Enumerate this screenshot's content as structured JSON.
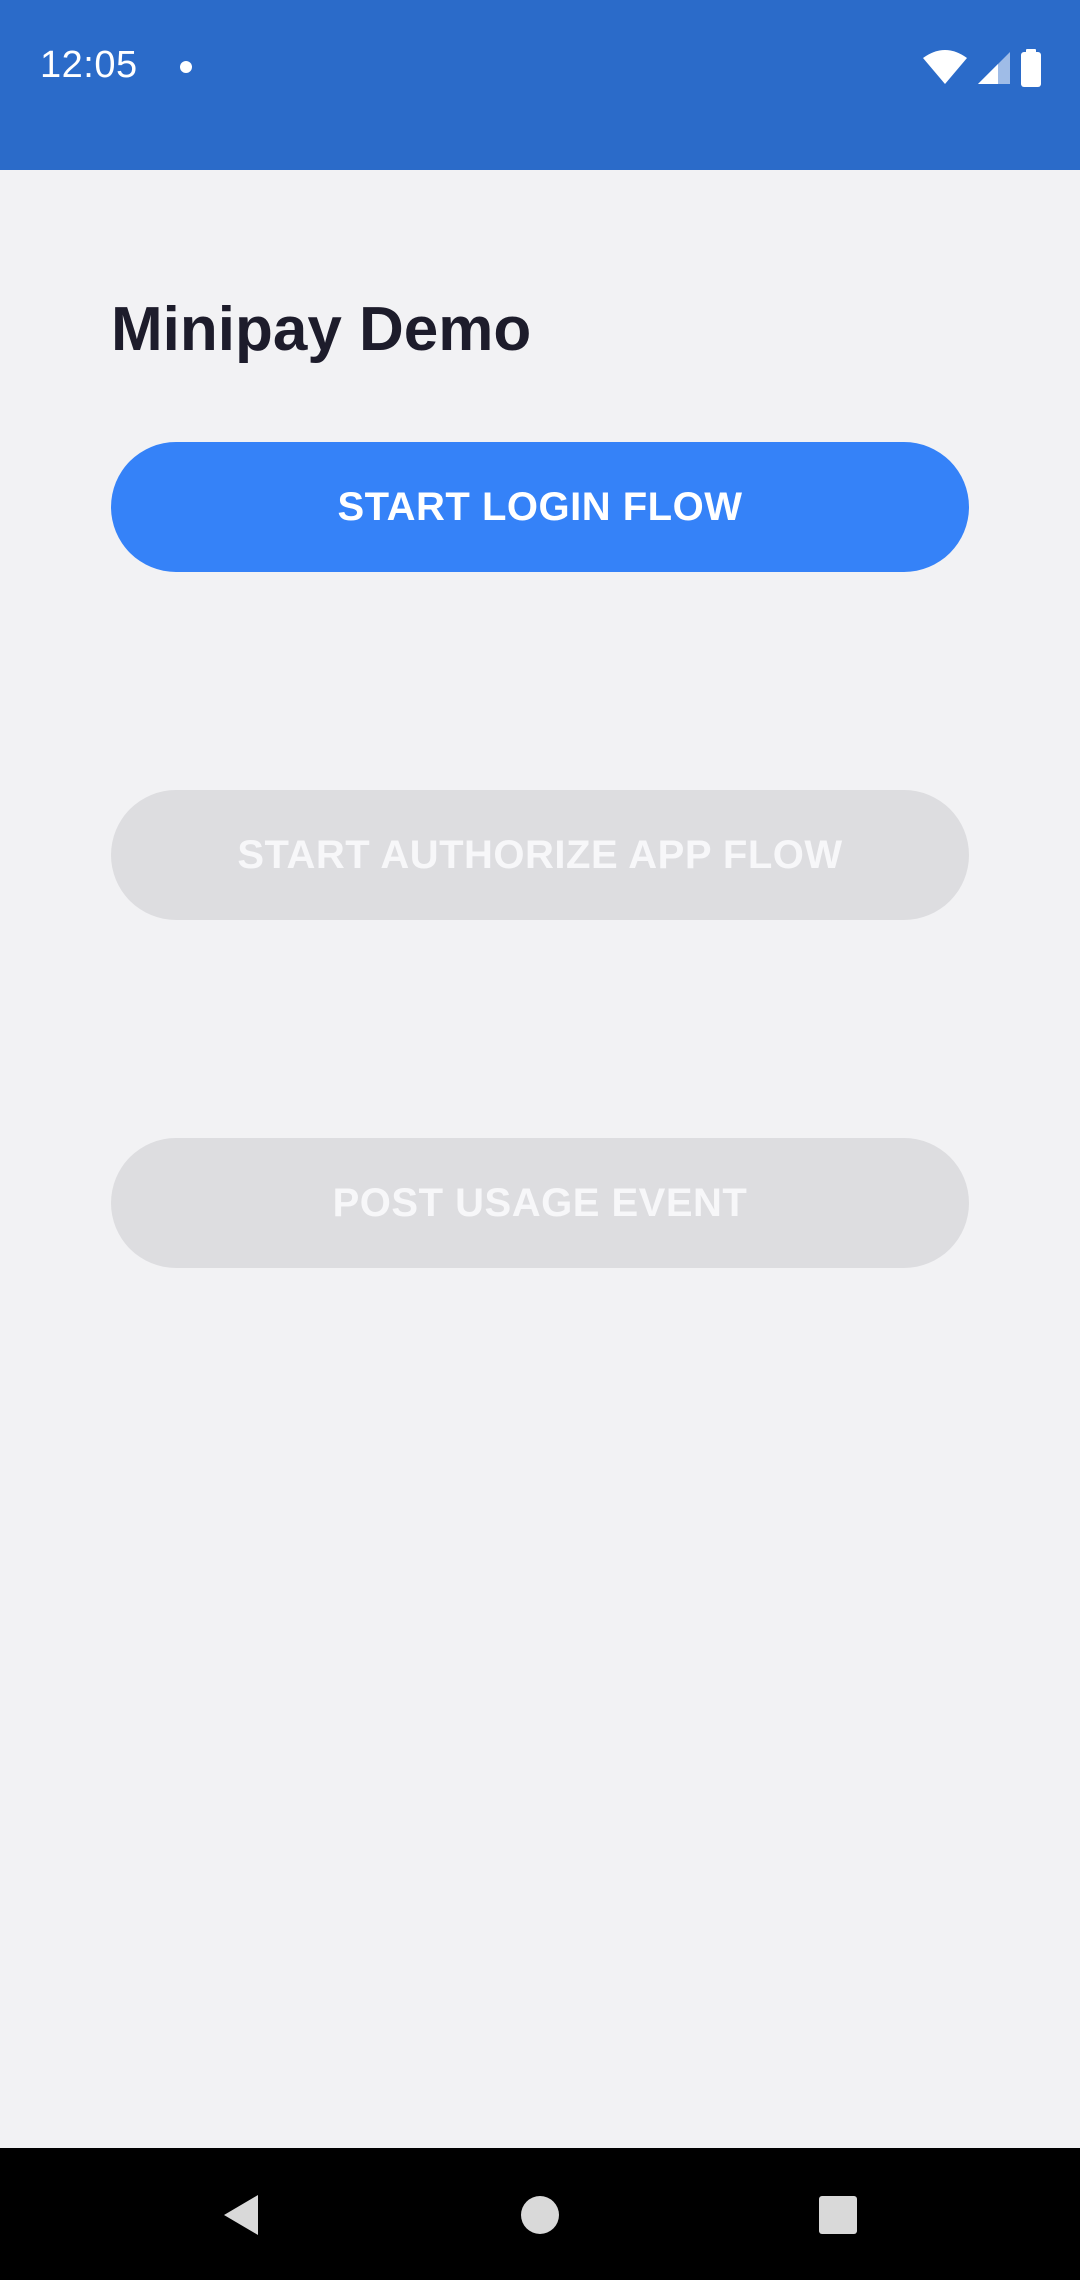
{
  "status_bar": {
    "time": "12:05",
    "background_color": "#2b6bc9",
    "icons": [
      "notification-dot-icon",
      "wifi-icon",
      "signal-icon",
      "battery-icon"
    ]
  },
  "main": {
    "title": "Minipay Demo",
    "buttons": [
      {
        "label": "START LOGIN FLOW",
        "enabled": true,
        "color": "#3582f8"
      },
      {
        "label": "START AUTHORIZE APP FLOW",
        "enabled": false,
        "color": "#dddde0"
      },
      {
        "label": "POST USAGE EVENT",
        "enabled": false,
        "color": "#dddde0"
      }
    ]
  },
  "nav_bar": {
    "icons": [
      "back-icon",
      "home-icon",
      "recents-icon"
    ]
  }
}
